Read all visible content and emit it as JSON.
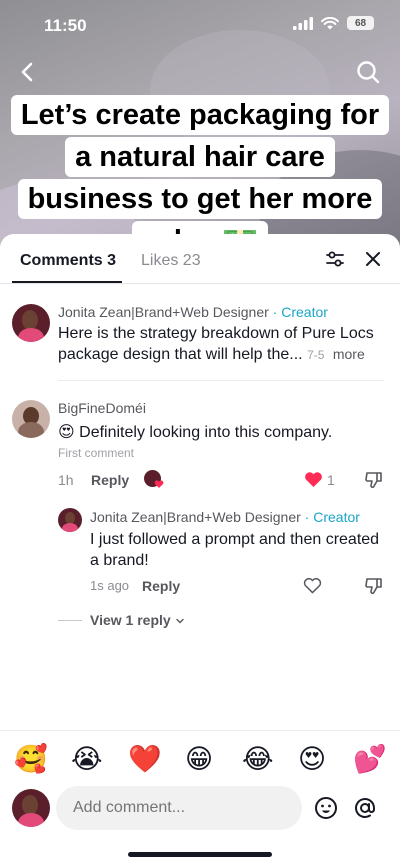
{
  "status": {
    "time": "11:50",
    "battery": "68"
  },
  "caption": {
    "lines": [
      "Let’s create packaging for",
      "a natural hair care",
      "business to get her more",
      "sales 💵"
    ]
  },
  "tabs": {
    "comments": "Comments 3",
    "likes": "Likes 23"
  },
  "comments": [
    {
      "author": "Jonita Zean|Brand+Web Designer",
      "badge": "· Creator",
      "text_line1": "Here is the strategy breakdown of Pure Locs",
      "text_line2": "package design that will help the...",
      "date": "7-5",
      "more": "more"
    },
    {
      "author": "BigFineDoméi",
      "emoji": "😍",
      "text": "Definitely looking into this company.",
      "label": "First comment",
      "time": "1h",
      "reply": "Reply",
      "likes": "1"
    },
    {
      "author": "Jonita Zean|Brand+Web Designer",
      "badge": "· Creator",
      "text_line1": "I just followed a prompt and then created",
      "text_line2": "a brand!",
      "time": "1s ago",
      "reply": "Reply"
    }
  ],
  "view_replies": "View 1 reply",
  "emoji_bar": [
    "🥰",
    "😭",
    "❤️",
    "😁",
    "😂",
    "😍",
    "💕"
  ],
  "input": {
    "placeholder": "Add comment..."
  },
  "colors": {
    "accent": "#1aa5c6",
    "like": "#fe2c55"
  }
}
